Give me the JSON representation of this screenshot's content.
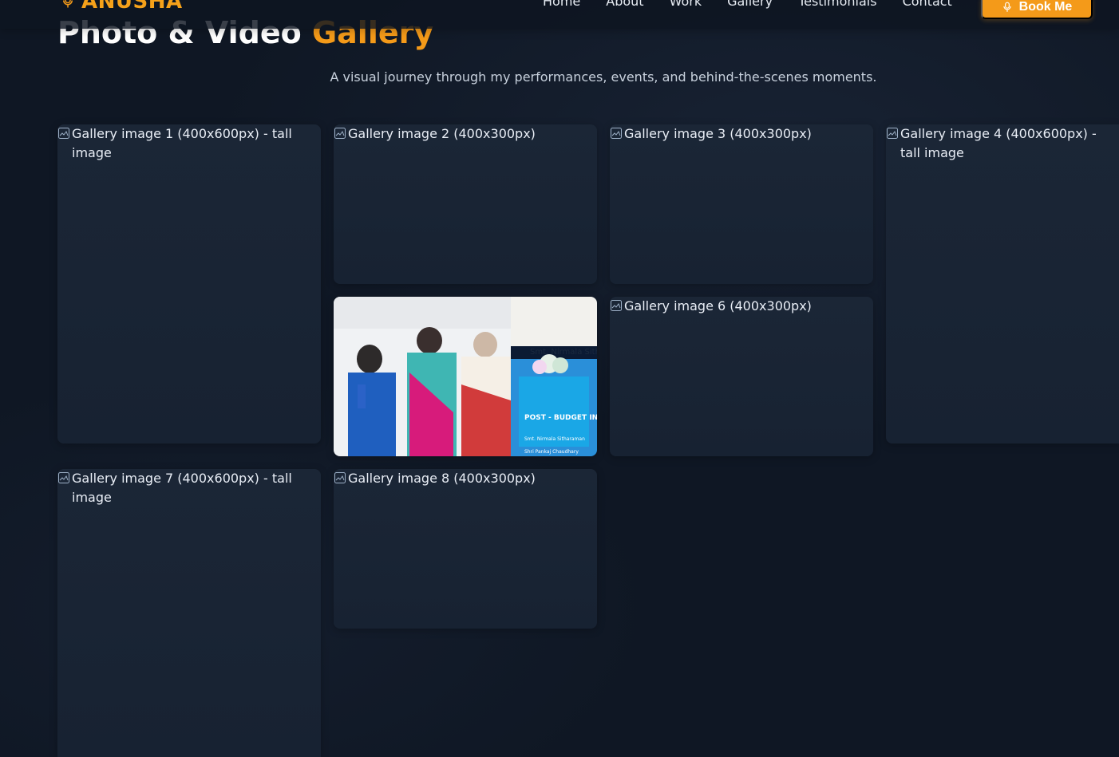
{
  "brand": {
    "name": "ANUSHA",
    "icon": "microphone-icon",
    "color": "#f49a19"
  },
  "nav": {
    "links": [
      "Home",
      "About",
      "Work",
      "Gallery",
      "Testimonials",
      "Contact"
    ],
    "cta": "Book Me",
    "cta_icon": "microphone-icon"
  },
  "header": {
    "title_plain": "Photo & Video",
    "title_accent": "Gallery",
    "subtitle": "A visual journey through my performances, events, and behind-the-scenes moments."
  },
  "gallery": {
    "items": [
      {
        "alt": "Gallery image 1 (400x600px) - tall image",
        "type": "broken"
      },
      {
        "alt": "Gallery image 2 (400x300px)",
        "type": "broken"
      },
      {
        "alt": "Gallery image 3 (400x300px)",
        "type": "broken"
      },
      {
        "alt": "Gallery image 4 (400x600px) - tall image",
        "type": "broken"
      },
      {
        "alt": "",
        "type": "photo",
        "photo_texts": {
          "sign_top": "Smt. Nirmala Sitharaman",
          "sign_main": "POST - BUDGET INTERACTION",
          "sign_line1": "Smt. Nirmala Sitharaman",
          "sign_line2": "Shri Pankaj Chaudhary"
        }
      },
      {
        "alt": "Gallery image 6 (400x300px)",
        "type": "broken"
      },
      {
        "alt": "Gallery image 7 (400x600px) - tall image",
        "type": "broken"
      },
      {
        "alt": "Gallery image 8 (400x300px)",
        "type": "broken"
      }
    ]
  },
  "colors": {
    "background": "#0f1724",
    "tile": "#1a2534",
    "accent": "#f49a19",
    "text": "#e8ecf2",
    "muted": "#c8d1dd"
  }
}
